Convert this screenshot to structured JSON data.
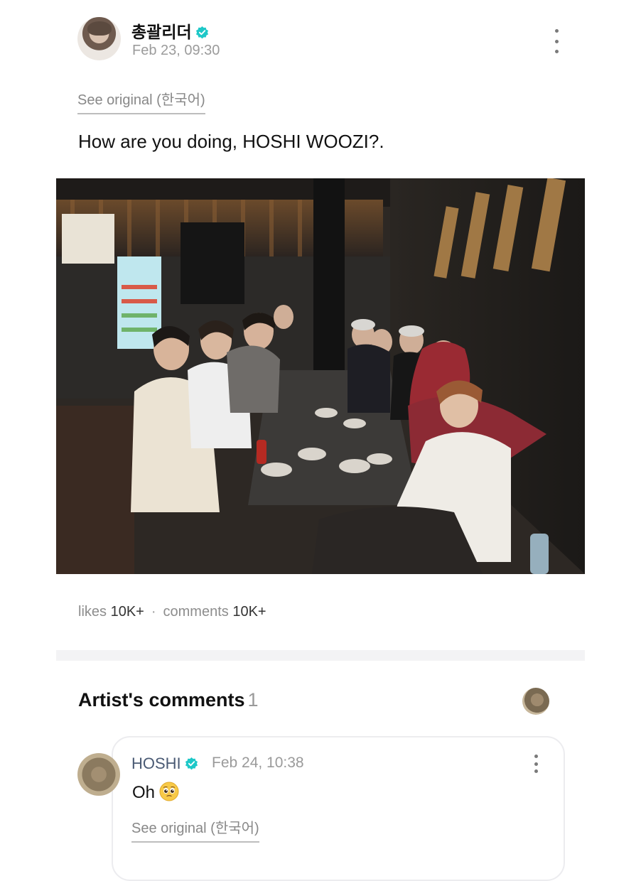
{
  "post": {
    "author_name": "총괄리더",
    "timestamp": "Feb 23, 09:30",
    "see_original": "See original (한국어)",
    "text": "How are you doing, HOSHI WOOZI?."
  },
  "stats": {
    "likes_label": "likes",
    "likes_value": "10K+",
    "separator": "·",
    "comments_label": "comments",
    "comments_value": "10K+"
  },
  "artist_comments": {
    "title": "Artist's comments",
    "count": "1"
  },
  "comment": {
    "author": "HOSHI",
    "timestamp": "Feb 24, 10:38",
    "text": "Oh",
    "emoji": "pleading-face",
    "see_original": "See original (한국어)"
  },
  "colors": {
    "verified_badge": "#1ec8c8",
    "divider": "#f3f3f5",
    "muted_text": "#8d8d8d"
  },
  "icons": {
    "verified": "verified-badge-icon",
    "more": "more-vertical-icon"
  }
}
